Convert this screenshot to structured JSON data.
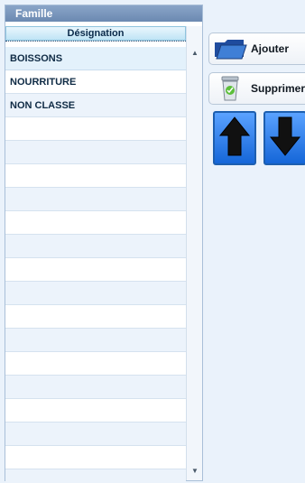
{
  "group": {
    "title": "Famille"
  },
  "grid": {
    "column_header": "Désignation",
    "rows": [
      "BOISSONS",
      "NOURRITURE",
      "NON CLASSE",
      "",
      "",
      "",
      "",
      "",
      "",
      "",
      "",
      "",
      "",
      "",
      "",
      "",
      "",
      "",
      ""
    ]
  },
  "actions": {
    "add_label": "Ajouter",
    "delete_label": "Supprimer"
  },
  "icons": {
    "scroll_up": "scroll-up-icon",
    "scroll_down": "scroll-down-icon",
    "folder": "folder-icon",
    "trash": "trash-icon",
    "move_up": "arrow-up-icon",
    "move_down": "arrow-down-icon"
  }
}
